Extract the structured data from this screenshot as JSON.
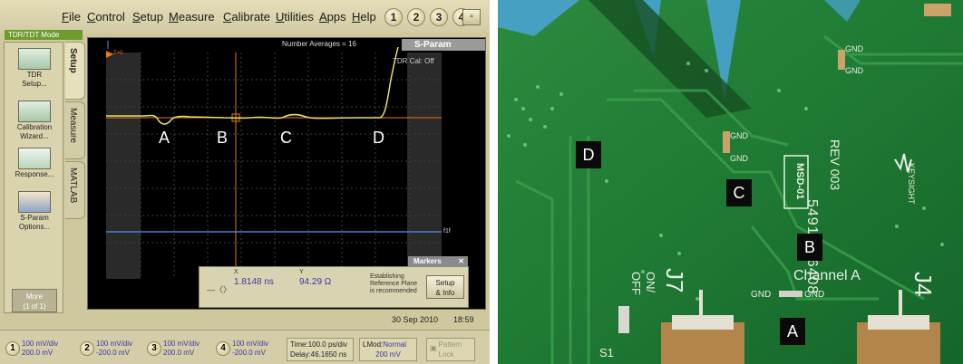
{
  "scope": {
    "menu": [
      "File",
      "Control",
      "Setup",
      "Measure",
      "Calibrate",
      "Utilities",
      "Apps",
      "Help"
    ],
    "channel_buttons": [
      "1",
      "2",
      "3",
      "4"
    ],
    "mode_tab": "TDR/TDT Mode",
    "sidebar": {
      "buttons": [
        {
          "label1": "TDR",
          "label2": "Setup..."
        },
        {
          "label1": "Calibration",
          "label2": "Wizard..."
        },
        {
          "label1": "Response...",
          "label2": ""
        },
        {
          "label1": "S-Param",
          "label2": "Options..."
        }
      ],
      "more": {
        "line1": "More",
        "line2": "(1 of 1)"
      }
    },
    "tabs": [
      "Setup",
      "Measure",
      "MATLAB"
    ],
    "screen": {
      "averages": "Number Averages =  16",
      "sparam_tab": "S-Param",
      "tdr_cal": "TDR Cal:  Off",
      "t0_label": "T+0",
      "trace_labels": [
        "A",
        "B",
        "C",
        "D"
      ],
      "f1_label": "f1f"
    },
    "markers": {
      "title": "Markers",
      "x_head": "X",
      "y_head": "Y",
      "x_value": "1.8148 ns",
      "y_value": "94.29 Ω",
      "note": "Establishing Reference Plane is recommended",
      "setup_line1": "Setup",
      "setup_line2": "& Info"
    },
    "date": "30 Sep 2010",
    "time": "18:59",
    "bottom": {
      "channels": [
        {
          "num": "1",
          "line1": "100 mV/div",
          "line2": "200.0 mV"
        },
        {
          "num": "2",
          "line1": "100 mV/div",
          "line2": "-200.0 mV"
        },
        {
          "num": "3",
          "line1": "100 mV/div",
          "line2": "200.0 mV"
        },
        {
          "num": "4",
          "line1": "100 mV/div",
          "line2": "-200.0 mV"
        }
      ],
      "timebase": {
        "line1": "Time:100.0 ps/div",
        "line2": "Delay:46.1650 ns"
      },
      "lmod": {
        "line1a": "LMod:",
        "line1b": "Normal",
        "line2": "200 mV"
      },
      "pattern_lock": {
        "line1": "Pattern",
        "line2": "Lock"
      }
    }
  },
  "pcb": {
    "gnd_labels": [
      "GND",
      "GND",
      "GND",
      "GND",
      "GND",
      "GND"
    ],
    "part_number": "54916-26408",
    "rev": "REV 003",
    "brand": "KEYSIGHT",
    "msd": "MSD-01",
    "channel_label": "Channel A",
    "j7": "J7",
    "j4": "J4",
    "on_label": "ON/",
    "off_label": "OFF",
    "s1": "S1",
    "markers": [
      "D",
      "C",
      "B",
      "A"
    ]
  }
}
